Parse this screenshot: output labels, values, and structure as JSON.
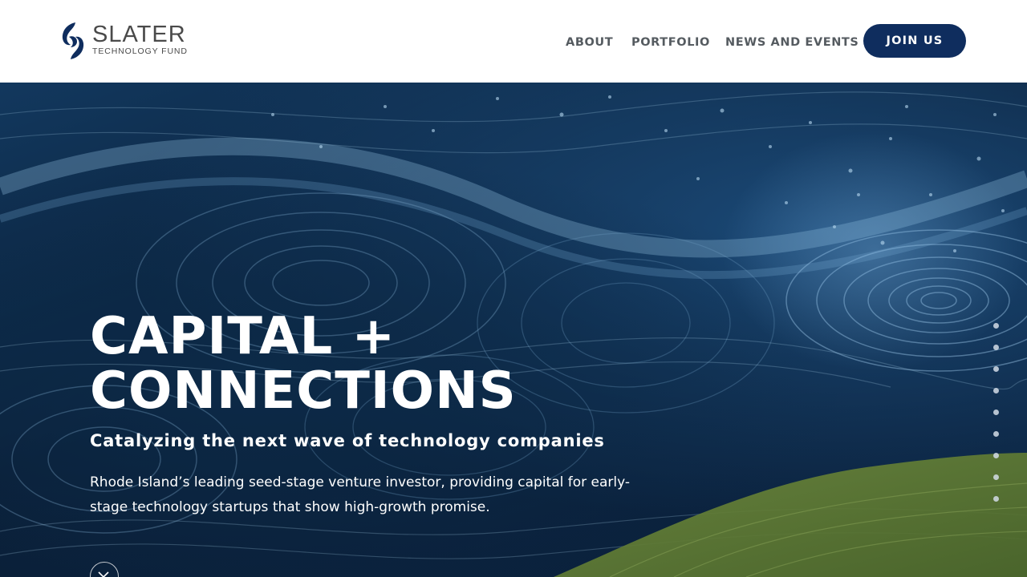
{
  "header": {
    "logo": {
      "word": "SLATER",
      "sub": "TECHNOLOGY FUND",
      "mark_color": "#0f2d5e"
    },
    "nav": [
      {
        "label": "ABOUT"
      },
      {
        "label": "PORTFOLIO"
      },
      {
        "label": "NEWS AND EVENTS"
      }
    ],
    "cta": {
      "label": "JOIN US",
      "color": "#0f2d5e"
    }
  },
  "hero": {
    "title_line1": "CAPITAL +",
    "title_line2": "CONNECTIONS",
    "subtitle": "Catalyzing the next wave of technology companies",
    "description": "Rhode Island’s leading seed-stage venture investor, providing capital for early-stage technology startups that show high-growth promise.",
    "scroll_icon": "chevron-down-icon",
    "slide_dots": 9
  }
}
